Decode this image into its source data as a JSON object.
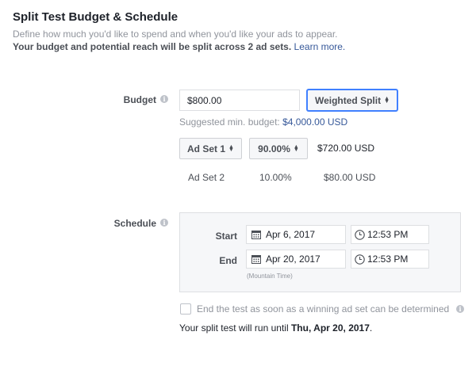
{
  "header": {
    "title": "Split Test Budget & Schedule",
    "description": "Define how much you'd like to spend and when you'd like your ads to appear.",
    "note": "Your budget and potential reach will be split across 2 ad sets.",
    "learn_more": "Learn more."
  },
  "budget": {
    "label": "Budget",
    "amount": "$800.00",
    "split_button": "Weighted Split",
    "suggested_prefix": "Suggested min. budget:",
    "suggested_value": "$4,000.00 USD",
    "ad_sets": [
      {
        "name": "Ad Set 1",
        "percent": "90.00%",
        "amount": "$720.00 USD"
      },
      {
        "name": "Ad Set 2",
        "percent": "10.00%",
        "amount": "$80.00 USD"
      }
    ]
  },
  "schedule": {
    "label": "Schedule",
    "start_label": "Start",
    "start_date": "Apr 6, 2017",
    "start_time": "12:53 PM",
    "end_label": "End",
    "end_date": "Apr 20, 2017",
    "end_time": "12:53 PM",
    "timezone": "(Mountain Time)",
    "end_early_label": "End the test as soon as a winning ad set can be determined",
    "run_until_prefix": "Your split test will run until",
    "run_until_date": "Thu, Apr 20, 2017",
    "run_until_suffix": "."
  },
  "colors": {
    "link": "#365899",
    "focus": "#4080ff"
  }
}
